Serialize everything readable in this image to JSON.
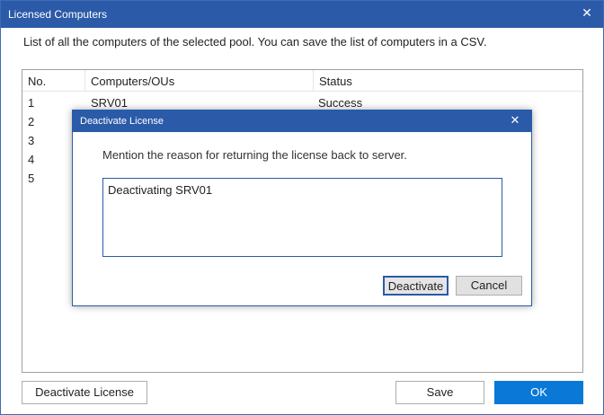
{
  "window": {
    "title": "Licensed Computers",
    "close_icon": "close-icon",
    "close_glyph": "✕",
    "description": "List of all the computers of the selected pool. You can save the list of computers in a CSV."
  },
  "list": {
    "columns": [
      "No.",
      "Computers/OUs",
      "Status"
    ],
    "rows": [
      {
        "no": "1",
        "computer": "SRV01",
        "status": "Success"
      },
      {
        "no": "2",
        "computer": "",
        "status": ""
      },
      {
        "no": "3",
        "computer": "",
        "status": ""
      },
      {
        "no": "4",
        "computer": "",
        "status": ""
      },
      {
        "no": "5",
        "computer": "",
        "status": ""
      }
    ]
  },
  "buttons": {
    "deactivate_license": "Deactivate License",
    "save": "Save",
    "ok": "OK"
  },
  "dialog": {
    "title": "Deactivate License",
    "close_glyph": "✕",
    "prompt": "Mention the reason for returning the license back to server.",
    "reason_value": "Deactivating SRV01",
    "deactivate_label": "Deactivate",
    "cancel_label": "Cancel"
  },
  "colors": {
    "titlebar": "#2b5aa8",
    "primary_button": "#0a78d7"
  }
}
